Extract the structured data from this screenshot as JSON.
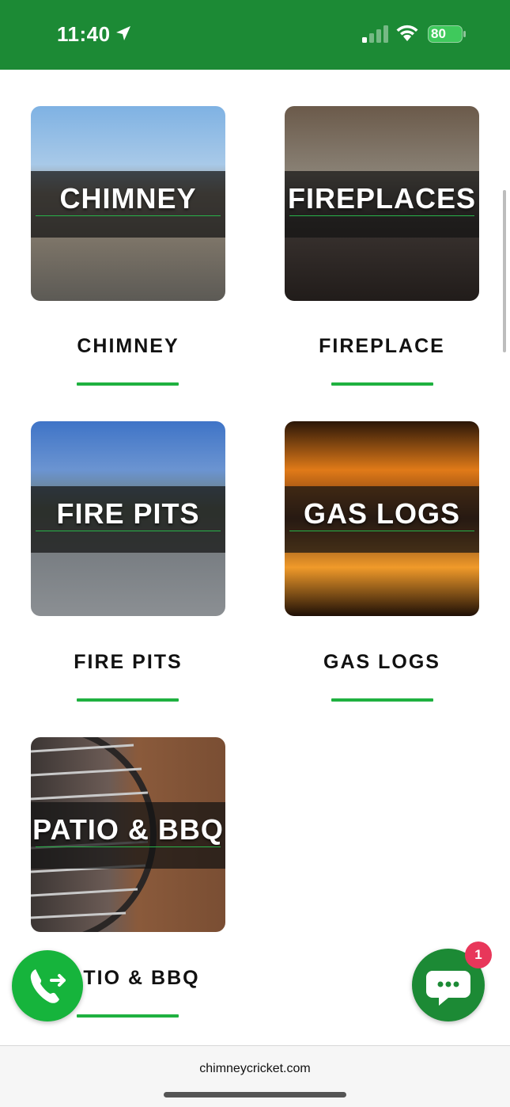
{
  "status_bar": {
    "time": "11:40",
    "battery": "80",
    "color": "#1c8a35"
  },
  "categories": [
    {
      "image_label": "CHIMNEY",
      "label": "CHIMNEY"
    },
    {
      "image_label": "FIREPLACES",
      "label": "FIREPLACE"
    },
    {
      "image_label": "FIRE PITS",
      "label": "FIRE PITS"
    },
    {
      "image_label": "GAS LOGS",
      "label": "GAS LOGS"
    },
    {
      "image_label": "PATIO & BBQ",
      "label": "TIO & BBQ"
    }
  ],
  "accent_color": "#1fb140",
  "phone_button": {
    "icon": "phone-forward-icon"
  },
  "chat_button": {
    "icon": "chat-bubble-icon",
    "badge": "1"
  },
  "browser": {
    "url": "chimneycricket.com"
  }
}
